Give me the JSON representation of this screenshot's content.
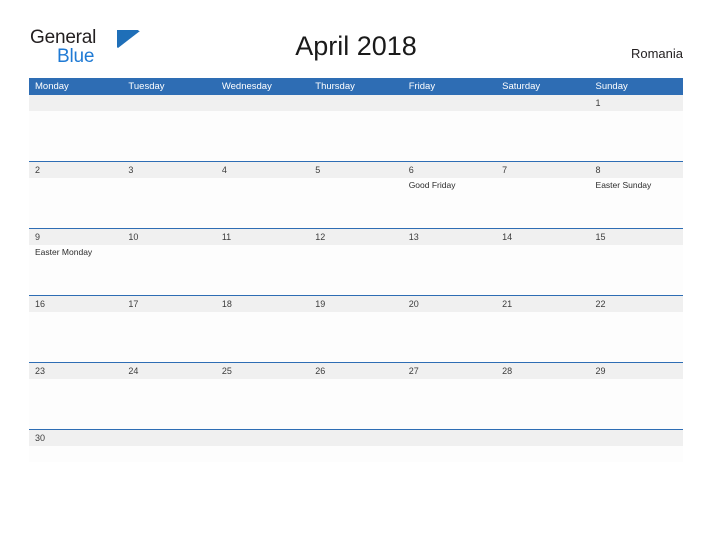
{
  "brand": {
    "word_one": "General",
    "word_two": "Blue",
    "mark": "triangle-flag-icon",
    "accent_color": "#2e6db4",
    "blue_text_color": "#1f7ad4"
  },
  "header": {
    "title": "April 2018",
    "country": "Romania"
  },
  "calendar": {
    "header_bg": "#2e6db4",
    "band_bg": "#f0f0f0",
    "weekdays": [
      "Monday",
      "Tuesday",
      "Wednesday",
      "Thursday",
      "Friday",
      "Saturday",
      "Sunday"
    ],
    "weeks": [
      {
        "size": "tall",
        "days": [
          {
            "num": "",
            "event": ""
          },
          {
            "num": "",
            "event": ""
          },
          {
            "num": "",
            "event": ""
          },
          {
            "num": "",
            "event": ""
          },
          {
            "num": "",
            "event": ""
          },
          {
            "num": "",
            "event": ""
          },
          {
            "num": "1",
            "event": ""
          }
        ]
      },
      {
        "size": "tall",
        "days": [
          {
            "num": "2",
            "event": ""
          },
          {
            "num": "3",
            "event": ""
          },
          {
            "num": "4",
            "event": ""
          },
          {
            "num": "5",
            "event": ""
          },
          {
            "num": "6",
            "event": "Good Friday"
          },
          {
            "num": "7",
            "event": ""
          },
          {
            "num": "8",
            "event": "Easter Sunday"
          }
        ]
      },
      {
        "size": "tall",
        "days": [
          {
            "num": "9",
            "event": "Easter Monday"
          },
          {
            "num": "10",
            "event": ""
          },
          {
            "num": "11",
            "event": ""
          },
          {
            "num": "12",
            "event": ""
          },
          {
            "num": "13",
            "event": ""
          },
          {
            "num": "14",
            "event": ""
          },
          {
            "num": "15",
            "event": ""
          }
        ]
      },
      {
        "size": "tall",
        "days": [
          {
            "num": "16",
            "event": ""
          },
          {
            "num": "17",
            "event": ""
          },
          {
            "num": "18",
            "event": ""
          },
          {
            "num": "19",
            "event": ""
          },
          {
            "num": "20",
            "event": ""
          },
          {
            "num": "21",
            "event": ""
          },
          {
            "num": "22",
            "event": ""
          }
        ]
      },
      {
        "size": "tall",
        "days": [
          {
            "num": "23",
            "event": ""
          },
          {
            "num": "24",
            "event": ""
          },
          {
            "num": "25",
            "event": ""
          },
          {
            "num": "26",
            "event": ""
          },
          {
            "num": "27",
            "event": ""
          },
          {
            "num": "28",
            "event": ""
          },
          {
            "num": "29",
            "event": ""
          }
        ]
      },
      {
        "size": "last",
        "days": [
          {
            "num": "30",
            "event": ""
          },
          {
            "num": "",
            "event": ""
          },
          {
            "num": "",
            "event": ""
          },
          {
            "num": "",
            "event": ""
          },
          {
            "num": "",
            "event": ""
          },
          {
            "num": "",
            "event": ""
          },
          {
            "num": "",
            "event": ""
          }
        ]
      }
    ]
  }
}
